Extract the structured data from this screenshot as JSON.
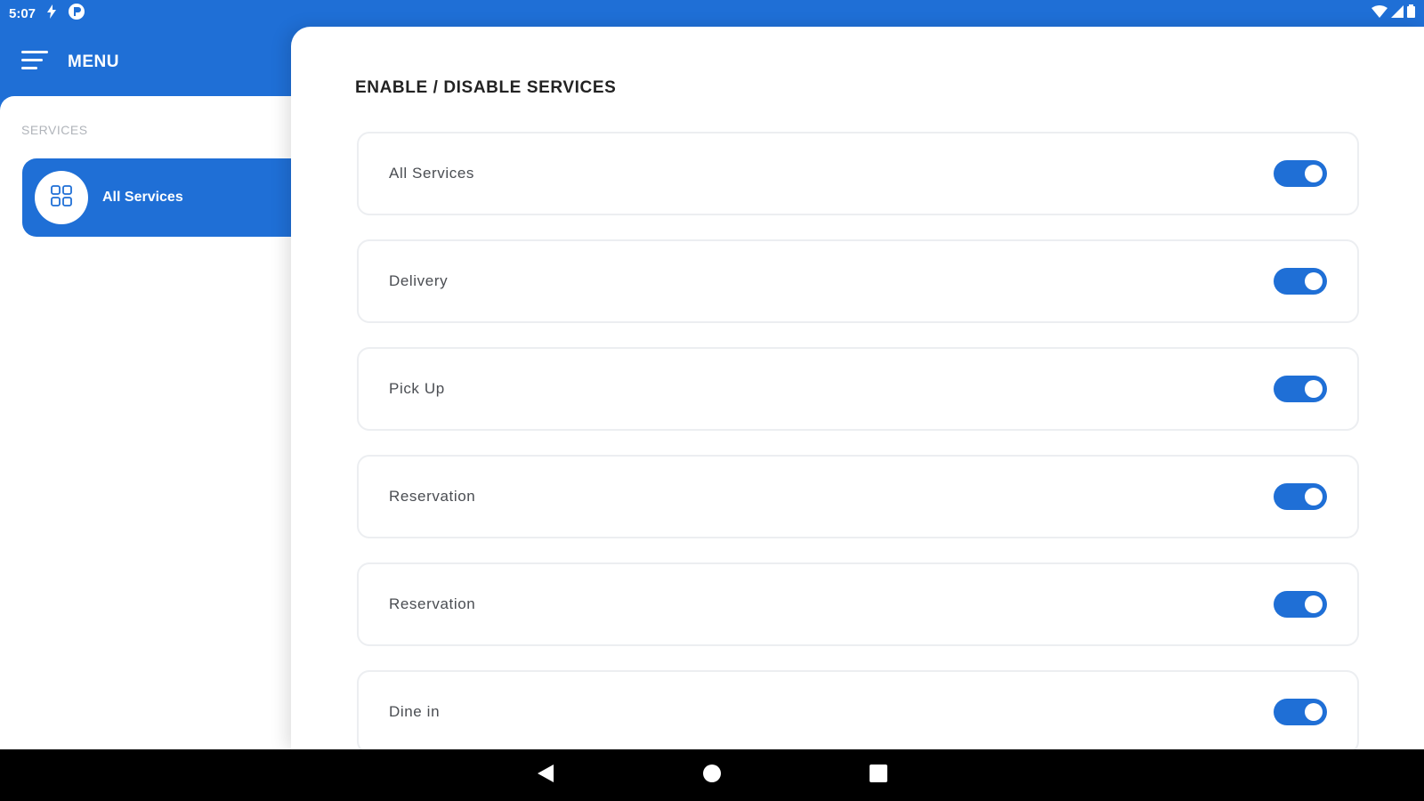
{
  "status_bar": {
    "time": "5:07",
    "icons": [
      "charging-bolt-icon",
      "app-notification-icon",
      "wifi-icon",
      "signal-icon",
      "battery-icon"
    ]
  },
  "sidebar": {
    "menu_label": "MENU",
    "section_label": "SERVICES",
    "items": [
      {
        "label": "All Services",
        "icon": "grid-icon",
        "active": true
      }
    ]
  },
  "main": {
    "title": "ENABLE / DISABLE SERVICES",
    "services": [
      {
        "label": "All Services",
        "enabled": true
      },
      {
        "label": "Delivery",
        "enabled": true
      },
      {
        "label": "Pick Up",
        "enabled": true
      },
      {
        "label": "Reservation",
        "enabled": true
      },
      {
        "label": "Reservation",
        "enabled": true
      },
      {
        "label": "Dine in",
        "enabled": true
      }
    ]
  },
  "nav_bar": {
    "buttons": [
      "back-icon",
      "home-icon",
      "recents-icon"
    ]
  },
  "colors": {
    "accent": "#1f6fd6",
    "background": "#ffffff",
    "card_border": "#eceef1",
    "nav_bar": "#000000"
  }
}
